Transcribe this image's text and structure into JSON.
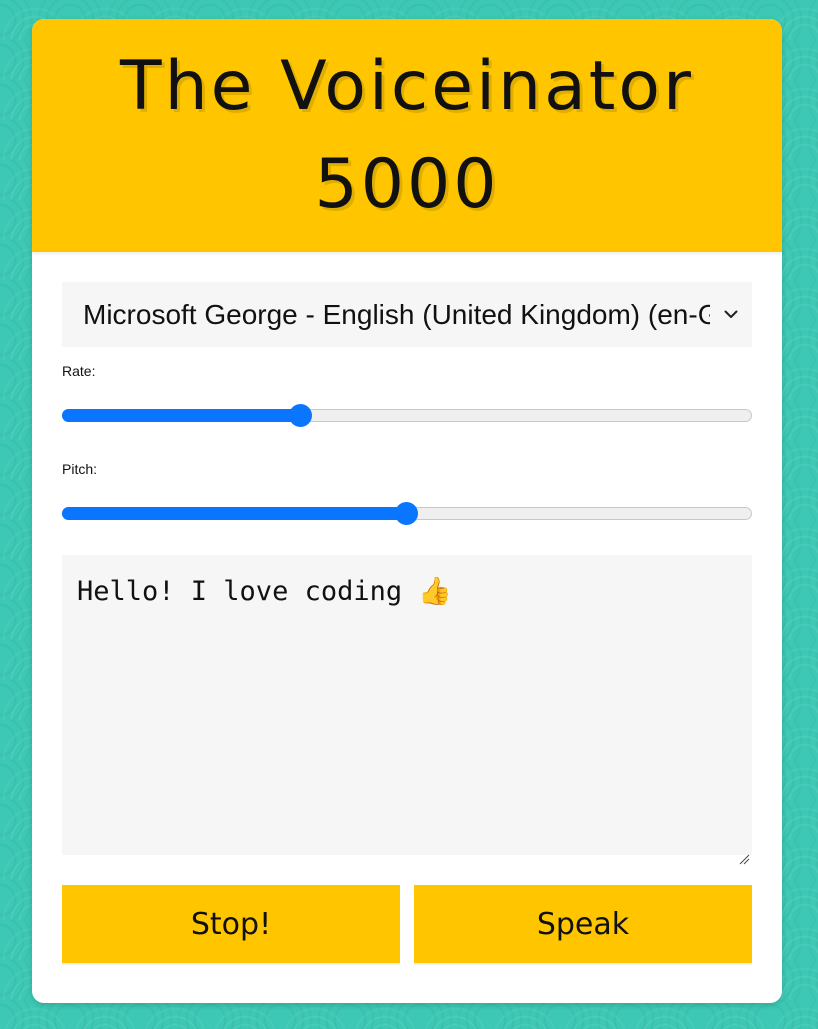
{
  "app": {
    "title": "The Voiceinator 5000"
  },
  "voice_select": {
    "selected": "Microsoft George - English (United Kingdom) (en-GB)",
    "icon": "chevron-down-icon"
  },
  "rate": {
    "label": "Rate:",
    "value_fraction": 0.346
  },
  "pitch": {
    "label": "Pitch:",
    "value_fraction": 0.5
  },
  "message": {
    "text": "Hello! I love coding 👍",
    "icon": "thumbs-up-icon"
  },
  "buttons": {
    "stop_label": "Stop!",
    "speak_label": "Speak"
  },
  "colors": {
    "background": "#3cc8b4",
    "header": "#ffc600",
    "accent": "#0a75ff",
    "button": "#ffc600"
  }
}
